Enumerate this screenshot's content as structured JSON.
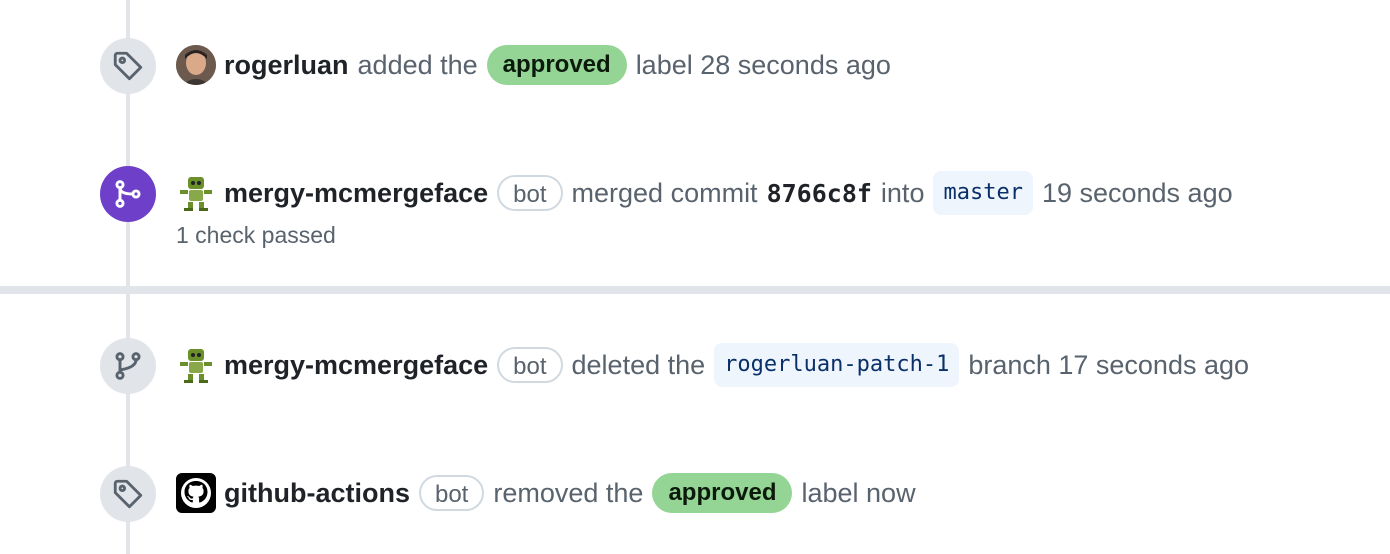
{
  "events": [
    {
      "icon": "tag-icon",
      "user": "rogerluan",
      "text_before": "added the",
      "label": "approved",
      "text_after": "label 28 seconds ago"
    },
    {
      "icon": "git-merge-icon",
      "user": "mergy-mcmergeface",
      "bot": "bot",
      "text_before": "merged commit",
      "sha": "8766c8f",
      "text_mid": "into",
      "branch": "master",
      "text_after": "19 seconds ago",
      "checks": "1 check passed"
    },
    {
      "icon": "git-branch-icon",
      "user": "mergy-mcmergeface",
      "bot": "bot",
      "text_before": "deleted the",
      "branch": "rogerluan-patch-1",
      "text_after": "branch 17 seconds ago"
    },
    {
      "icon": "tag-icon",
      "user": "github-actions",
      "bot": "bot",
      "text_before": "removed the",
      "label": "approved",
      "text_after": "label now"
    }
  ],
  "colors": {
    "merged_purple": "#6e40c9",
    "label_green": "#94d494",
    "timeline_gray": "#e1e4e8"
  }
}
